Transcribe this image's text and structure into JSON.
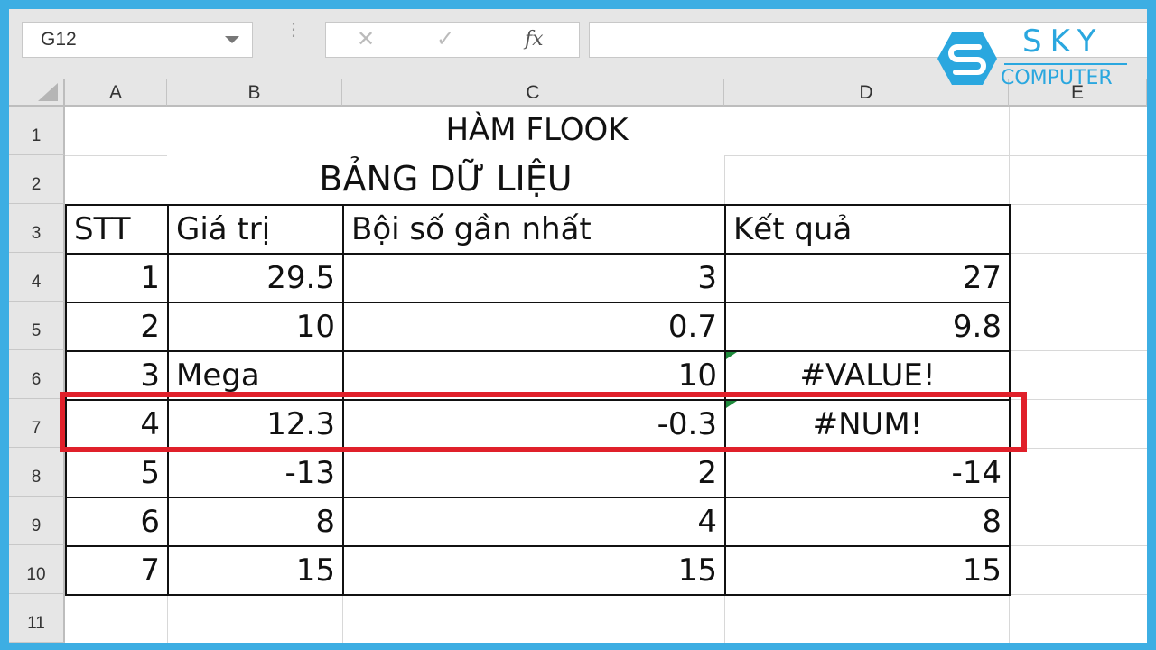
{
  "formula_bar": {
    "name_box": "G12",
    "cancel_icon": "✕",
    "enter_icon": "✓",
    "fx_label": "fx",
    "formula": ""
  },
  "logo": {
    "brand": "SKY",
    "subtitle": "COMPUTER",
    "color": "#2aa7df"
  },
  "columns": [
    "A",
    "B",
    "C",
    "D",
    "E"
  ],
  "rows": [
    "1",
    "2",
    "3",
    "4",
    "5",
    "6",
    "7",
    "8",
    "9",
    "10",
    "11"
  ],
  "sheet": {
    "title": "HÀM FLOOK",
    "subtitle": "BẢNG DỮ LIỆU",
    "headers": [
      "STT",
      "Giá trị",
      "Bội số gần nhất",
      "Kết quả"
    ],
    "data": [
      [
        "1",
        "29.5",
        "3",
        "27"
      ],
      [
        "2",
        "10",
        "0.7",
        "9.8"
      ],
      [
        "3",
        "Mega",
        "10",
        "#VALUE!"
      ],
      [
        "4",
        "12.3",
        "-0.3",
        "#NUM!"
      ],
      [
        "5",
        "-13",
        "2",
        "-14"
      ],
      [
        "6",
        "8",
        "4",
        "8"
      ],
      [
        "7",
        "15",
        "15",
        "15"
      ]
    ]
  },
  "highlight": {
    "row": "7",
    "color": "#e0202a"
  },
  "frame_color": "#3daee3"
}
